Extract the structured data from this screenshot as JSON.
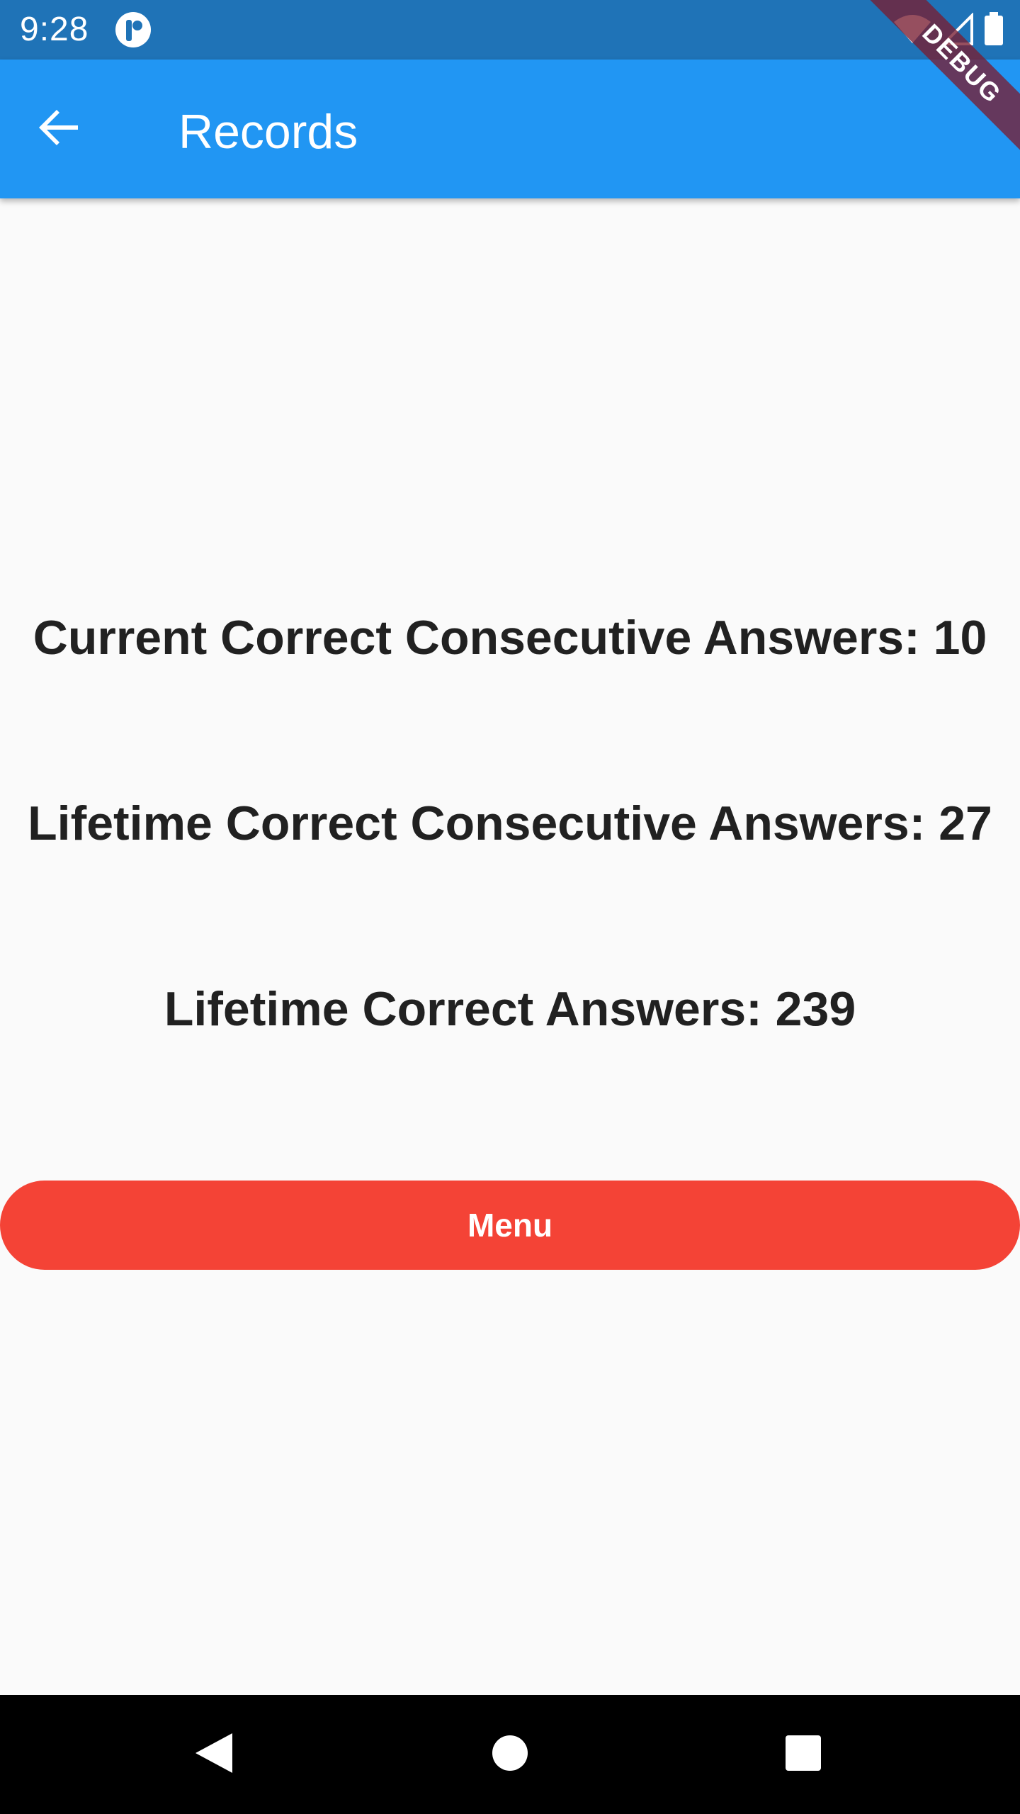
{
  "status_bar": {
    "time": "9:28",
    "icons": [
      "app-notification-icon",
      "wifi-icon",
      "signal-icon",
      "battery-icon"
    ]
  },
  "debug_banner": {
    "label": "DEBUG"
  },
  "app_bar": {
    "title": "Records",
    "back_icon": "arrow-back-icon",
    "background_color": "#2196f3"
  },
  "records": {
    "current_correct_consecutive": "Current Correct Consecutive Answers: 10",
    "lifetime_correct_consecutive": "Lifetime Correct Consecutive Answers: 27",
    "lifetime_correct": "Lifetime Correct Answers: 239"
  },
  "menu_button": {
    "label": "Menu",
    "color": "#f44336"
  },
  "nav_bar": {
    "buttons": [
      "nav-back-icon",
      "nav-home-icon",
      "nav-recents-icon"
    ]
  }
}
